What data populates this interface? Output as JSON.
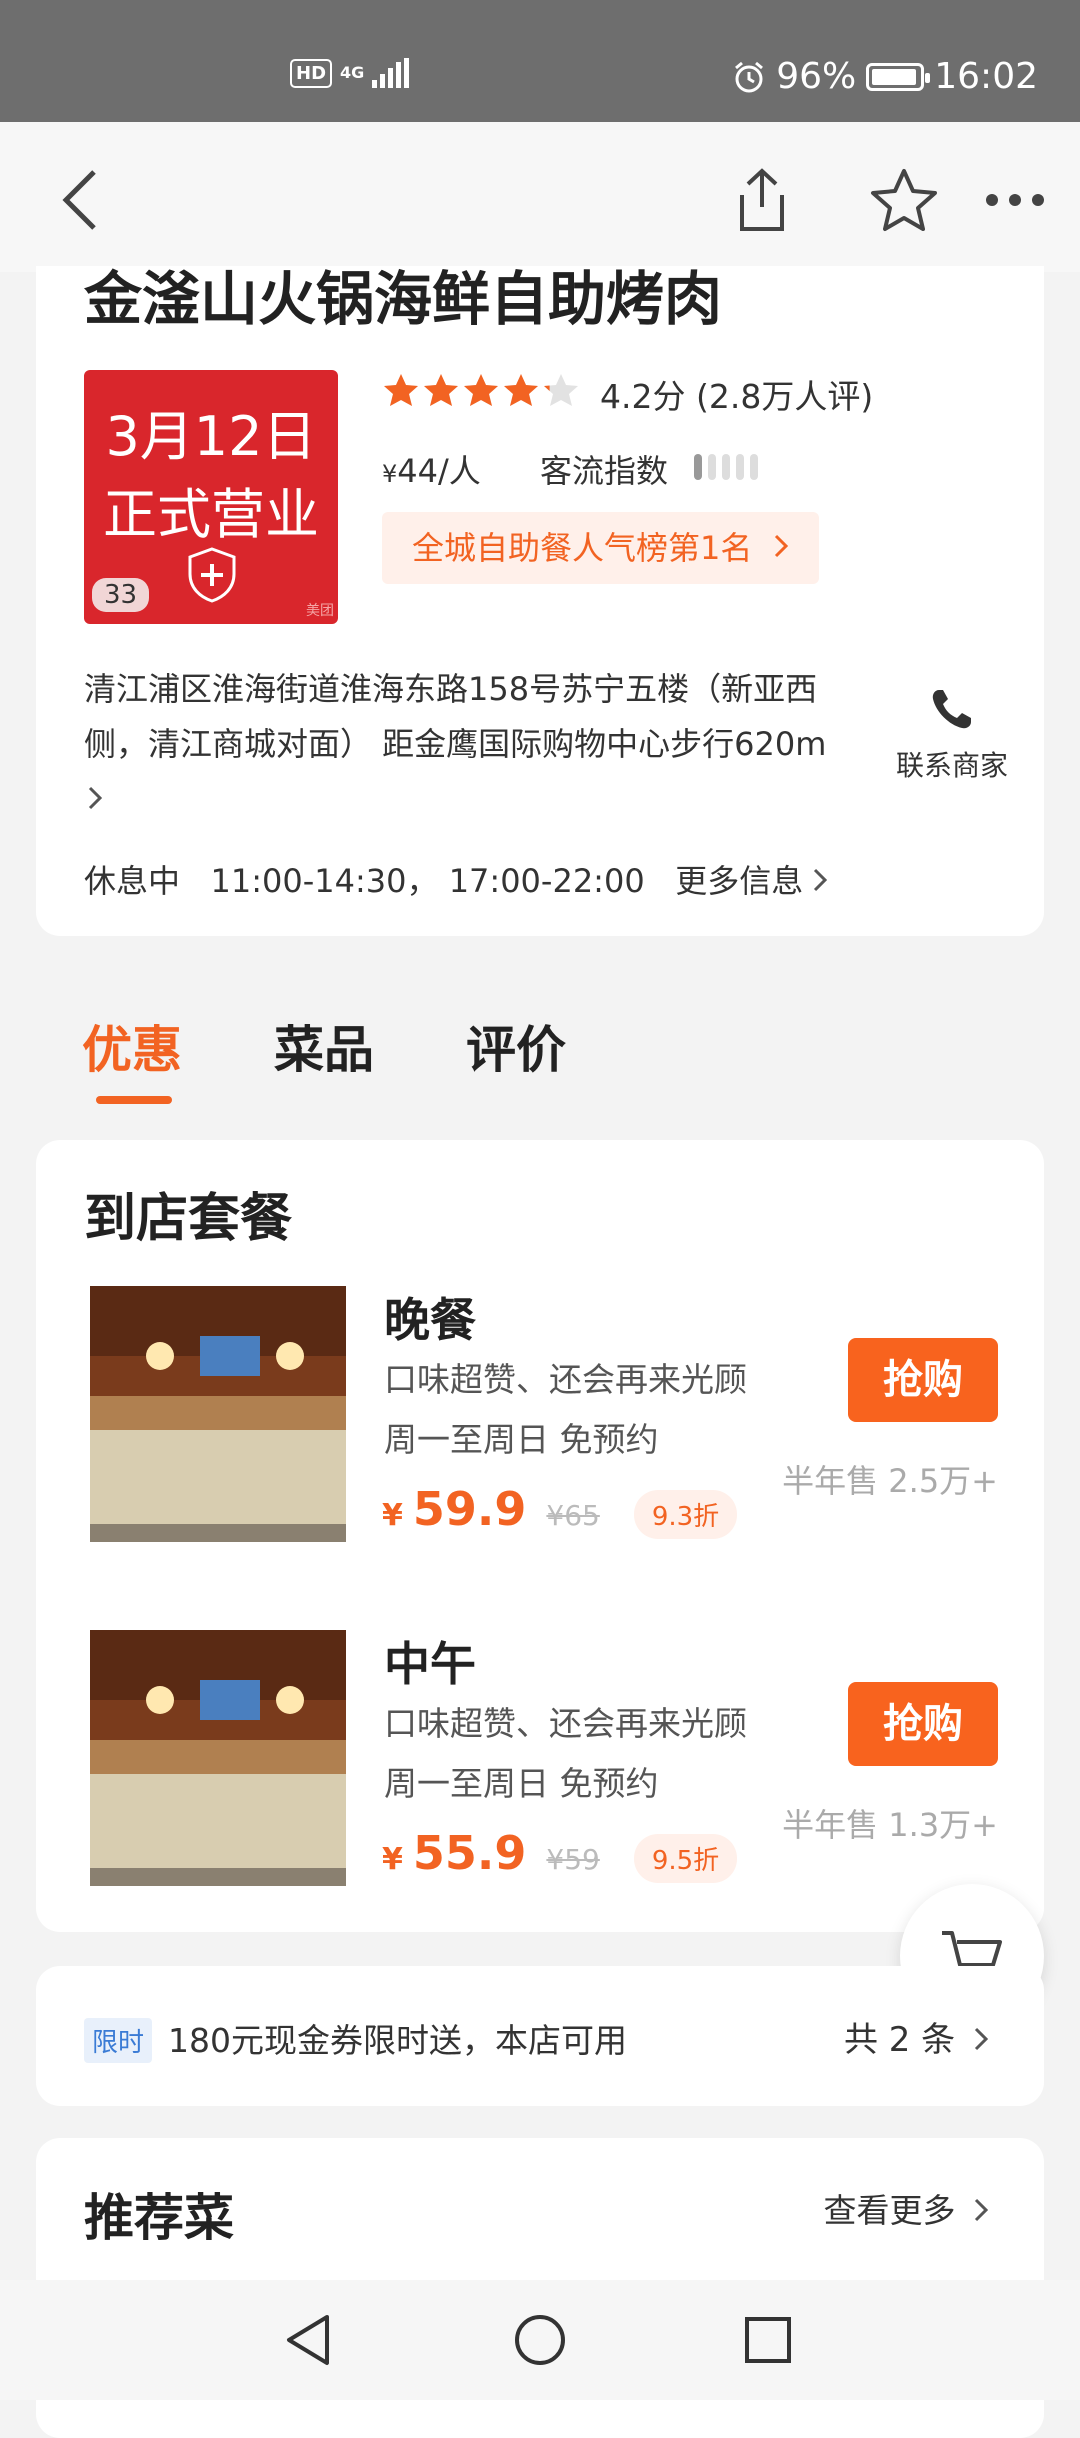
{
  "status_bar": {
    "hd_label": "HD",
    "network": "4G",
    "battery_percent": "96%",
    "battery_level": 0.96,
    "time": "16:02"
  },
  "nav": {
    "back_icon": "back-arrow-icon",
    "share_icon": "share-icon",
    "favorite_icon": "star-outline-icon",
    "more_icon": "more-dots-icon"
  },
  "shop": {
    "name": "金滏山火锅海鲜自助烤肉",
    "cover": {
      "line1": "3月12日",
      "line2": "正式营业",
      "photo_count": "33",
      "watermark": "美团"
    },
    "rating_value": 4.2,
    "rating_text": "4.2分",
    "review_count_text": "(2.8万人评)",
    "price_symbol": "¥",
    "price_per_person": "44/人",
    "flow_label": "客流指数",
    "flow_level": 1,
    "flow_max": 5,
    "rank_badge": "全城自助餐人气榜第1名",
    "address": "清江浦区淮海街道淮海东路158号苏宁五楼（新亚西侧，清江商城对面） 距金鹰国际购物中心步行620m",
    "contact_label": "联系商家",
    "status": "休息中",
    "hours": "11:00-14:30， 17:00-22:00",
    "more_info": "更多信息",
    "colors": {
      "accent": "#f26322",
      "cover_red": "#d9262c",
      "star": "#f26322"
    }
  },
  "tabs": [
    {
      "label": "优惠",
      "active": true
    },
    {
      "label": "菜品",
      "active": false
    },
    {
      "label": "评价",
      "active": false
    }
  ],
  "deals": {
    "title": "到店套餐",
    "items": [
      {
        "name": "晚餐",
        "desc1": "口味超赞、还会再来光顾",
        "desc2": "周一至周日  免预约",
        "currency": "¥",
        "price": "59.9",
        "original_price": "¥65",
        "discount": "9.3折",
        "buy_label": "抢购",
        "sold": "半年售 2.5万+"
      },
      {
        "name": "中午",
        "desc1": "口味超赞、还会再来光顾",
        "desc2": "周一至周日  免预约",
        "currency": "¥",
        "price": "55.9",
        "original_price": "¥59",
        "discount": "9.5折",
        "buy_label": "抢购",
        "sold": "半年售 1.3万+"
      }
    ]
  },
  "coupon": {
    "tag": "限时",
    "text": "180元现金券限时送，本店可用",
    "count": "共 2 条"
  },
  "recommend": {
    "title": "推荐菜",
    "more": "查看更多"
  },
  "cart_icon": "shopping-cart-icon",
  "system_nav": {
    "back": "triangle-back-icon",
    "home": "circle-home-icon",
    "recents": "square-recents-icon"
  }
}
